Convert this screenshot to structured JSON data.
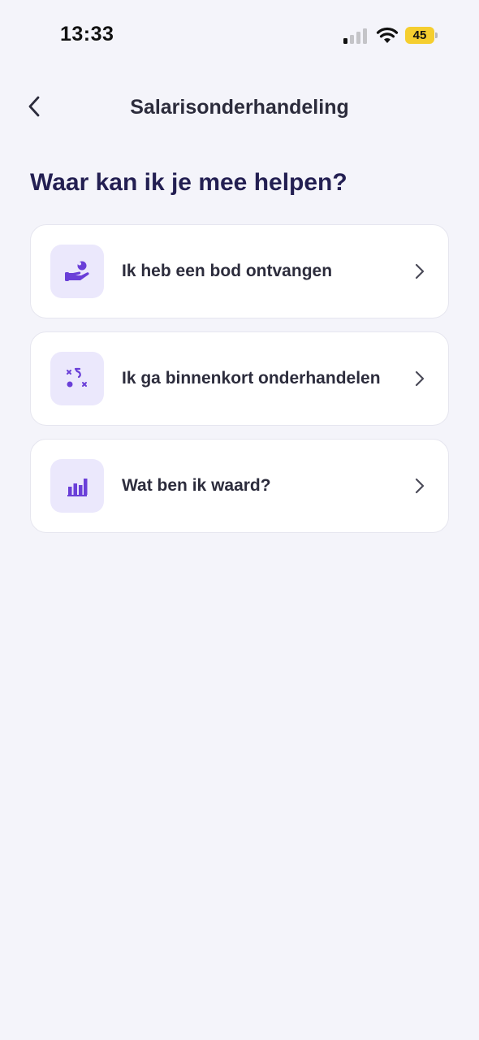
{
  "status_bar": {
    "time": "13:33",
    "battery_level": "45",
    "signal_icon": "cellular-signal-icon",
    "wifi_icon": "wifi-icon",
    "battery_color": "#f5ce2f"
  },
  "header": {
    "back_icon": "chevron-left-icon",
    "title": "Salarisonderhandeling"
  },
  "main": {
    "heading": "Waar kan ik je mee helpen?",
    "options": [
      {
        "label": "Ik heb een bod ontvangen",
        "icon": "hand-offer-icon"
      },
      {
        "label": "Ik ga binnenkort onderhandelen",
        "icon": "strategy-icon"
      },
      {
        "label": "Wat ben ik waard?",
        "icon": "bar-chart-icon"
      }
    ]
  },
  "colors": {
    "background": "#f4f4fa",
    "accent": "#6a3fd8",
    "icon_tile": "#ebe8fc",
    "heading": "#231f52"
  }
}
